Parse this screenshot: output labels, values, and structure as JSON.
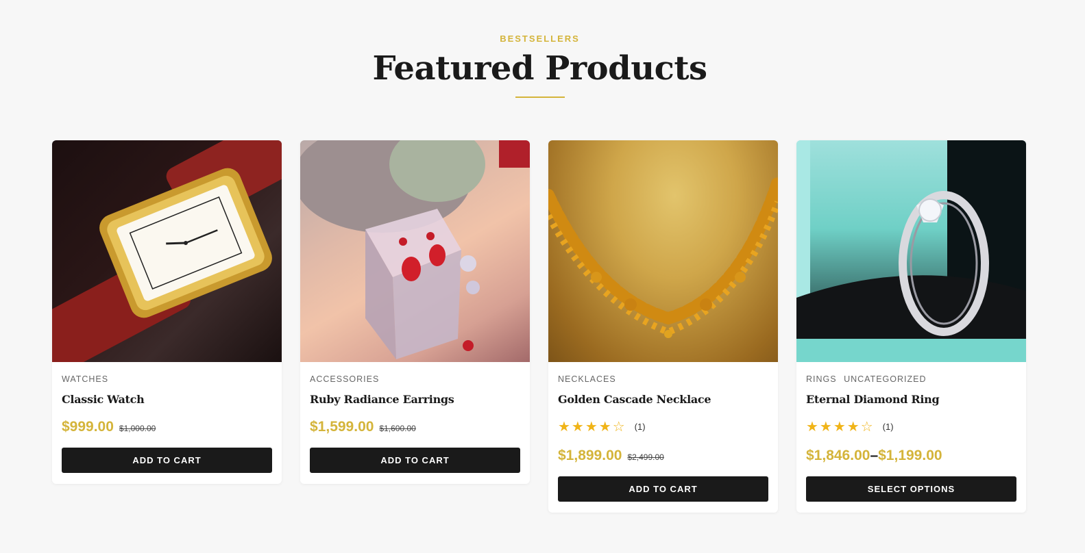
{
  "section": {
    "eyebrow": "BESTSELLERS",
    "title": "Featured Products"
  },
  "products": [
    {
      "categories": [
        "WATCHES"
      ],
      "name": "Classic Watch",
      "price": "$999.00",
      "old_price": "$1,000.00",
      "button": "ADD TO CART",
      "image": "gold rectangular wristwatch on red leather strap"
    },
    {
      "categories": [
        "ACCESSORIES"
      ],
      "name": "Ruby Radiance Earrings",
      "price": "$1,599.00",
      "old_price": "$1,600.00",
      "button": "ADD TO CART",
      "image": "ruby drop earrings on clear crystal cube"
    },
    {
      "categories": [
        "NECKLACES"
      ],
      "name": "Golden Cascade Necklace",
      "rating": 4.5,
      "stars": "★★★★☆",
      "review_count": "(1)",
      "price": "$1,899.00",
      "old_price": "$2,499.00",
      "button": "ADD TO CART",
      "image": "ornate gold necklace on golden background"
    },
    {
      "categories": [
        "RINGS",
        "UNCATEGORIZED"
      ],
      "name": "Eternal Diamond Ring",
      "rating": 4.5,
      "stars": "★★★★☆",
      "review_count": "(1)",
      "price_low": "$1,846.00",
      "dash": "–",
      "price_high": "$1,199.00",
      "button": "SELECT OPTIONS",
      "image": "diamond ring in black velvet box with teal lining"
    }
  ],
  "colors": {
    "accent": "#d4b43a",
    "button": "#1a1a1a",
    "star": "#f0b418",
    "background": "#f7f7f7"
  }
}
